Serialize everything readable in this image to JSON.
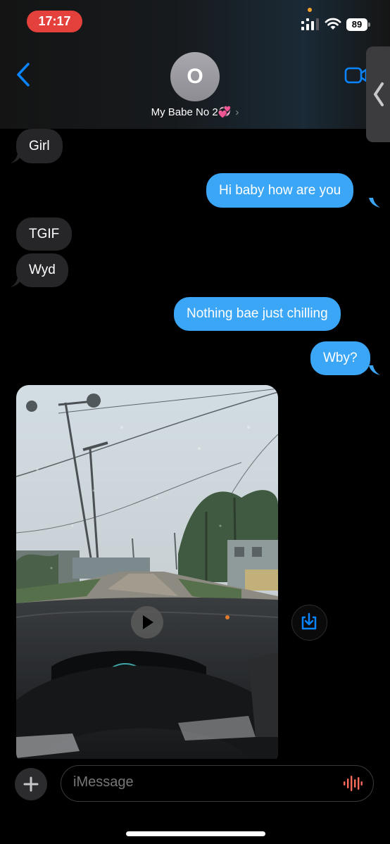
{
  "status_bar": {
    "time": "17:17",
    "battery": "89",
    "icons": [
      "cellular-signal-icon",
      "wifi-icon",
      "battery-icon"
    ]
  },
  "header": {
    "avatar_initial": "O",
    "contact_name": "My Babe No 2💞",
    "chevron": "›",
    "icons": [
      "back-chevron-icon",
      "video-call-icon",
      "side-handle-chevron-icon"
    ]
  },
  "messages": [
    {
      "direction": "incoming",
      "text": "Girl"
    },
    {
      "direction": "outgoing",
      "text": "Hi baby how are you"
    },
    {
      "direction": "incoming",
      "text": "TGIF"
    },
    {
      "direction": "incoming",
      "text": "Wyd"
    },
    {
      "direction": "outgoing",
      "text": "Nothing bae just chilling"
    },
    {
      "direction": "outgoing",
      "text": "Wby?"
    },
    {
      "direction": "incoming",
      "type": "video",
      "icons": [
        "play-icon",
        "download-icon"
      ]
    }
  ],
  "composer": {
    "placeholder": "iMessage",
    "icons": [
      "plus-icon",
      "audio-waveform-icon"
    ]
  },
  "colors": {
    "outgoing_bubble": "#3ba6f6",
    "incoming_bubble": "#262628",
    "time_pill": "#e5413c",
    "accent": "#0a84ff",
    "mic": "#ff6b5a"
  }
}
